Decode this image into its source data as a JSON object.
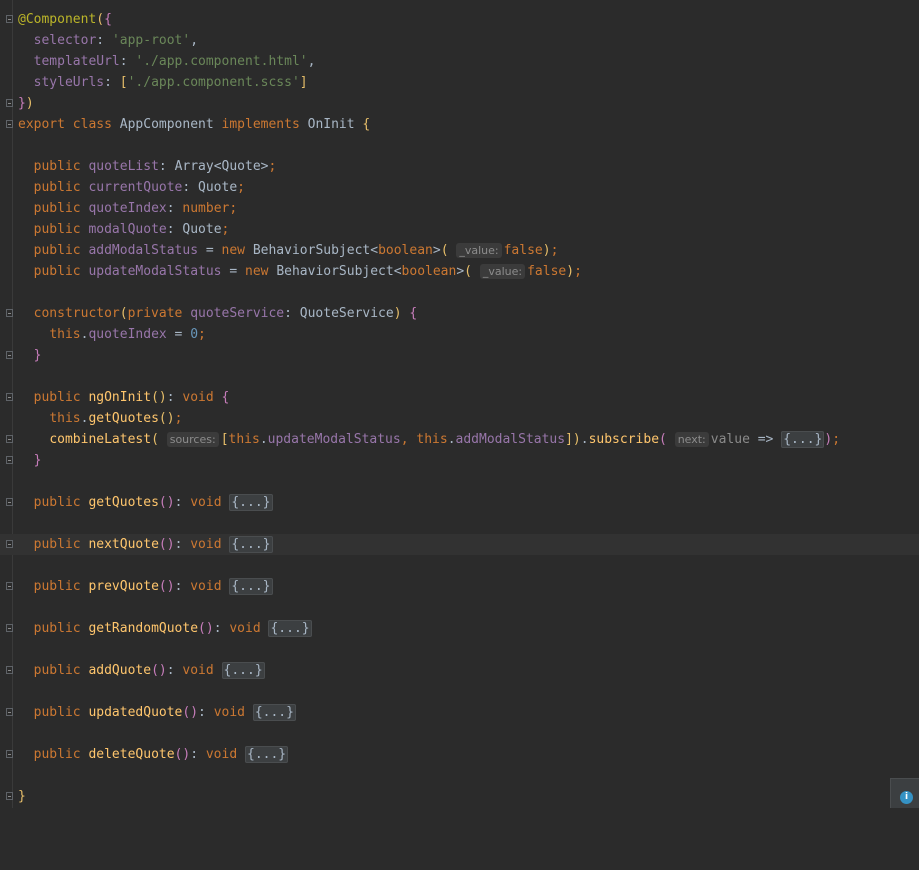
{
  "decorator": "@Component",
  "selector_key": "selector",
  "selector_value": "'app-root'",
  "template_key": "templateUrl",
  "template_value": "'./app.component.html'",
  "styles_key": "styleUrls",
  "styles_value": "'./app.component.scss'",
  "class_decl": {
    "export": "export",
    "class": "class",
    "name": "AppComponent",
    "implements": "implements",
    "iface": "OnInit"
  },
  "fields": [
    {
      "name": "quoteList",
      "type": "Array<Quote>"
    },
    {
      "name": "currentQuote",
      "type": "Quote"
    },
    {
      "name": "quoteIndex",
      "type": "number"
    },
    {
      "name": "modalQuote",
      "type": "Quote"
    }
  ],
  "subjects": [
    {
      "name": "addModalStatus",
      "ctor": "BehaviorSubject",
      "generic": "boolean",
      "hint": "_value:",
      "value": "false"
    },
    {
      "name": "updateModalStatus",
      "ctor": "BehaviorSubject",
      "generic": "boolean",
      "hint": "_value:",
      "value": "false"
    }
  ],
  "constructor": {
    "kw": "constructor",
    "param": "quoteService",
    "type": "QuoteService",
    "prop": "quoteIndex",
    "value": "0"
  },
  "ngOnInit": {
    "name": "ngOnInit",
    "call": "getQuotes",
    "combine": "combineLatest",
    "hint_sources": "sources:",
    "arg1": "updateModalStatus",
    "arg2": "addModalStatus",
    "subscribe": "subscribe",
    "hint_next": "next:",
    "param": "value",
    "folded": "{...}"
  },
  "methods": [
    {
      "name": "getQuotes",
      "folded": "{...}"
    },
    {
      "name": "nextQuote",
      "folded": "{...}"
    },
    {
      "name": "prevQuote",
      "folded": "{...}"
    },
    {
      "name": "getRandomQuote",
      "folded": "{...}"
    },
    {
      "name": "addQuote",
      "folded": "{...}"
    },
    {
      "name": "updatedQuote",
      "folded": "{...}"
    },
    {
      "name": "deleteQuote",
      "folded": "{...}"
    }
  ],
  "keywords": {
    "public": "public",
    "private": "private",
    "new": "new",
    "void": "void",
    "this": "this",
    "true": "true"
  },
  "info_icon": "i"
}
